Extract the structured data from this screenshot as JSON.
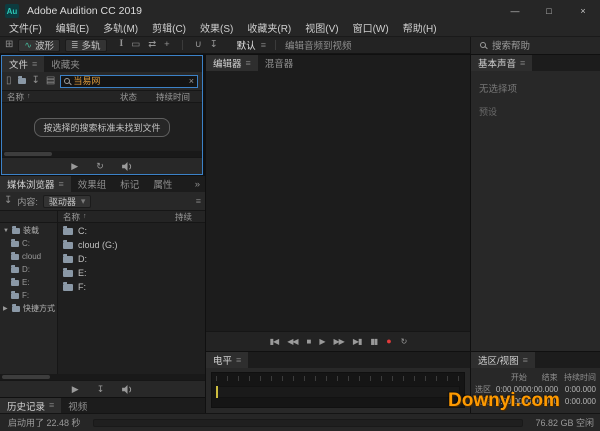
{
  "titlebar": {
    "title": "Adobe Audition CC 2019",
    "app_badge": "Au",
    "minimize": "—",
    "maximize": "□",
    "close": "×"
  },
  "menu": {
    "items": [
      "文件(F)",
      "编辑(E)",
      "多轨(M)",
      "剪辑(C)",
      "效果(S)",
      "收藏夹(R)",
      "视图(V)",
      "窗口(W)",
      "帮助(H)"
    ]
  },
  "toolbar": {
    "waveform": "波形",
    "multitrack": "多轨",
    "workspace": "默认",
    "workspace_alt": "编辑音频到视频",
    "search_help": "搜索帮助"
  },
  "files_panel": {
    "tab_files": "文件",
    "tab_favorites": "收藏夹",
    "search_text": "当易网",
    "col_name": "名称",
    "col_status": "状态",
    "col_duration": "持续时间",
    "empty_message": "按选择的搜索标准未找到文件"
  },
  "media_panel": {
    "tab_media": "媒体浏览器",
    "tab_effects": "效果组",
    "tab_markers": "标记",
    "tab_properties": "属性",
    "content_label": "内容:",
    "content_value": "驱动器",
    "col_name": "名称",
    "col_duration": "持续",
    "tree_mounted": "装载",
    "tree_shortcuts": "快捷方式",
    "tree_drives": [
      "C:",
      "cloud",
      "D:",
      "E:",
      "F:"
    ],
    "drives": [
      "C:",
      "cloud (G:)",
      "D:",
      "E:",
      "F:"
    ]
  },
  "bottom_tabs": {
    "history": "历史记录",
    "video": "视频"
  },
  "editor": {
    "tab_editor": "编辑器",
    "tab_mixer": "混音器"
  },
  "levels": {
    "tab": "电平"
  },
  "essential_sound": {
    "tab": "基本声音",
    "line1": "无选择项",
    "line2": "预设"
  },
  "selection_view": {
    "tab": "选区/视图",
    "col_start": "开始",
    "col_end": "结束",
    "col_duration": "持续时间",
    "rows": [
      {
        "label": "选区",
        "start": "0:00.000",
        "end": "0:00.000",
        "duration": "0:00.000"
      },
      {
        "label": "视图",
        "start": "0:00.000",
        "end": "0:00.000",
        "duration": "0:00.000"
      }
    ]
  },
  "statusbar": {
    "left": "启动用了 22.48 秒",
    "right": "76.82 GB 空闲"
  },
  "watermark": {
    "text": "Downyi.com",
    "color": "#ff9a00"
  },
  "colors": {
    "accent_blue": "#3c82c8",
    "record_red": "#e23b3b",
    "search_orange": "#e09c3c",
    "panel_bg": "#282828"
  },
  "icons": {
    "menu": "≡",
    "more": "»",
    "sort_up": "↑",
    "dropdown": "▾",
    "grid": "⊞",
    "waveform": "∿",
    "multitrack": "≣",
    "tool_ibeam": "I",
    "tool_marquee": "▭",
    "tool_slip": "⇄",
    "tool_move": "+",
    "snap": "∪",
    "import": "↧",
    "page": "▯",
    "list": "▤",
    "play": "▶",
    "stop": "■",
    "pause": "▮▮",
    "skip_start": "▮◀",
    "rewind": "◀◀",
    "forward": "▶▶",
    "skip_end": "▶▮",
    "loop": "↻",
    "record": "●",
    "tree_open": "▼",
    "tree_closed": "▶",
    "close_x": "×",
    "divider": "|"
  }
}
